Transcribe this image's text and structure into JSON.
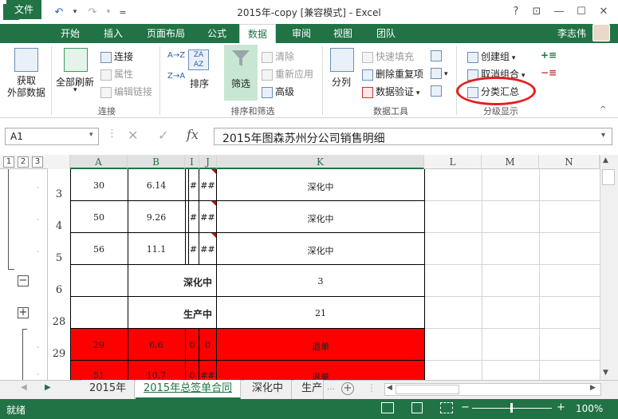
{
  "title": "2015年-copy  [兼容模式] - Excel",
  "window": {
    "help": "?",
    "ribbon_opts": "⊡",
    "minimize": "—",
    "maximize": "☐",
    "close": "✕"
  },
  "qat": {
    "excel_logo": "X",
    "save": "💾",
    "undo": "↶",
    "redo": "↷",
    "customize": "="
  },
  "tabs": [
    {
      "label": "文件"
    },
    {
      "label": "开始"
    },
    {
      "label": "插入"
    },
    {
      "label": "页面布局"
    },
    {
      "label": "公式"
    },
    {
      "label": "数据"
    },
    {
      "label": "审阅"
    },
    {
      "label": "视图"
    },
    {
      "label": "团队"
    }
  ],
  "user": "李志伟",
  "ribbon": {
    "get_external": "获取\n外部数据",
    "refresh_all": "全部刷新",
    "connections": "连接",
    "properties": "属性",
    "edit_links": "编辑链接",
    "group_connections": "连接",
    "sort_az": "A→Z",
    "sort_za": "Z→A",
    "sort": "排序",
    "filter": "筛选",
    "clear": "清除",
    "reapply": "重新应用",
    "advanced": "高级",
    "group_sort_filter": "排序和筛选",
    "split": "分列",
    "flash_fill": "快速填充",
    "remove_dupes": "删除重复项",
    "validation": "数据验证",
    "group_tools": "数据工具",
    "group_create": "创建组",
    "ungroup": "取消组合",
    "subtotal": "分类汇总",
    "group_outline": "分级显示"
  },
  "name_box": "A1",
  "formula_value": "2015年图森苏州分公司销售明细",
  "levels": [
    "1",
    "2",
    "3"
  ],
  "columns": [
    "A",
    "B",
    "I",
    "J",
    "K",
    "L",
    "M",
    "N"
  ],
  "rows": [
    {
      "num": "3",
      "a": "30",
      "b": "6.14",
      "i": "#",
      "j": "##",
      "k": "深化中"
    },
    {
      "num": "4",
      "a": "50",
      "b": "9.26",
      "i": "#",
      "j": "##",
      "k": "深化中"
    },
    {
      "num": "5",
      "a": "56",
      "b": "11.1",
      "i": "#",
      "j": "##",
      "k": "深化中"
    },
    {
      "num": "6",
      "label": "深化中",
      "k": "3"
    },
    {
      "num": "28",
      "label": "生产中",
      "k": "21"
    },
    {
      "num": "29",
      "a": "29",
      "b": "6.6",
      "i": "0",
      "j": "0",
      "k": "退单"
    },
    {
      "num": "",
      "a": "51",
      "b": "10.7",
      "i": "0",
      "j": "##",
      "k": "退单"
    }
  ],
  "sheets": [
    "2015年",
    "2015年总签单合同",
    "深化中",
    "生产"
  ],
  "status": {
    "ready": "就绪",
    "zoom": "100%"
  },
  "colors": {
    "excel_green": "#217346",
    "red_fill": "#ff0000",
    "circle": "#e81d1d"
  }
}
